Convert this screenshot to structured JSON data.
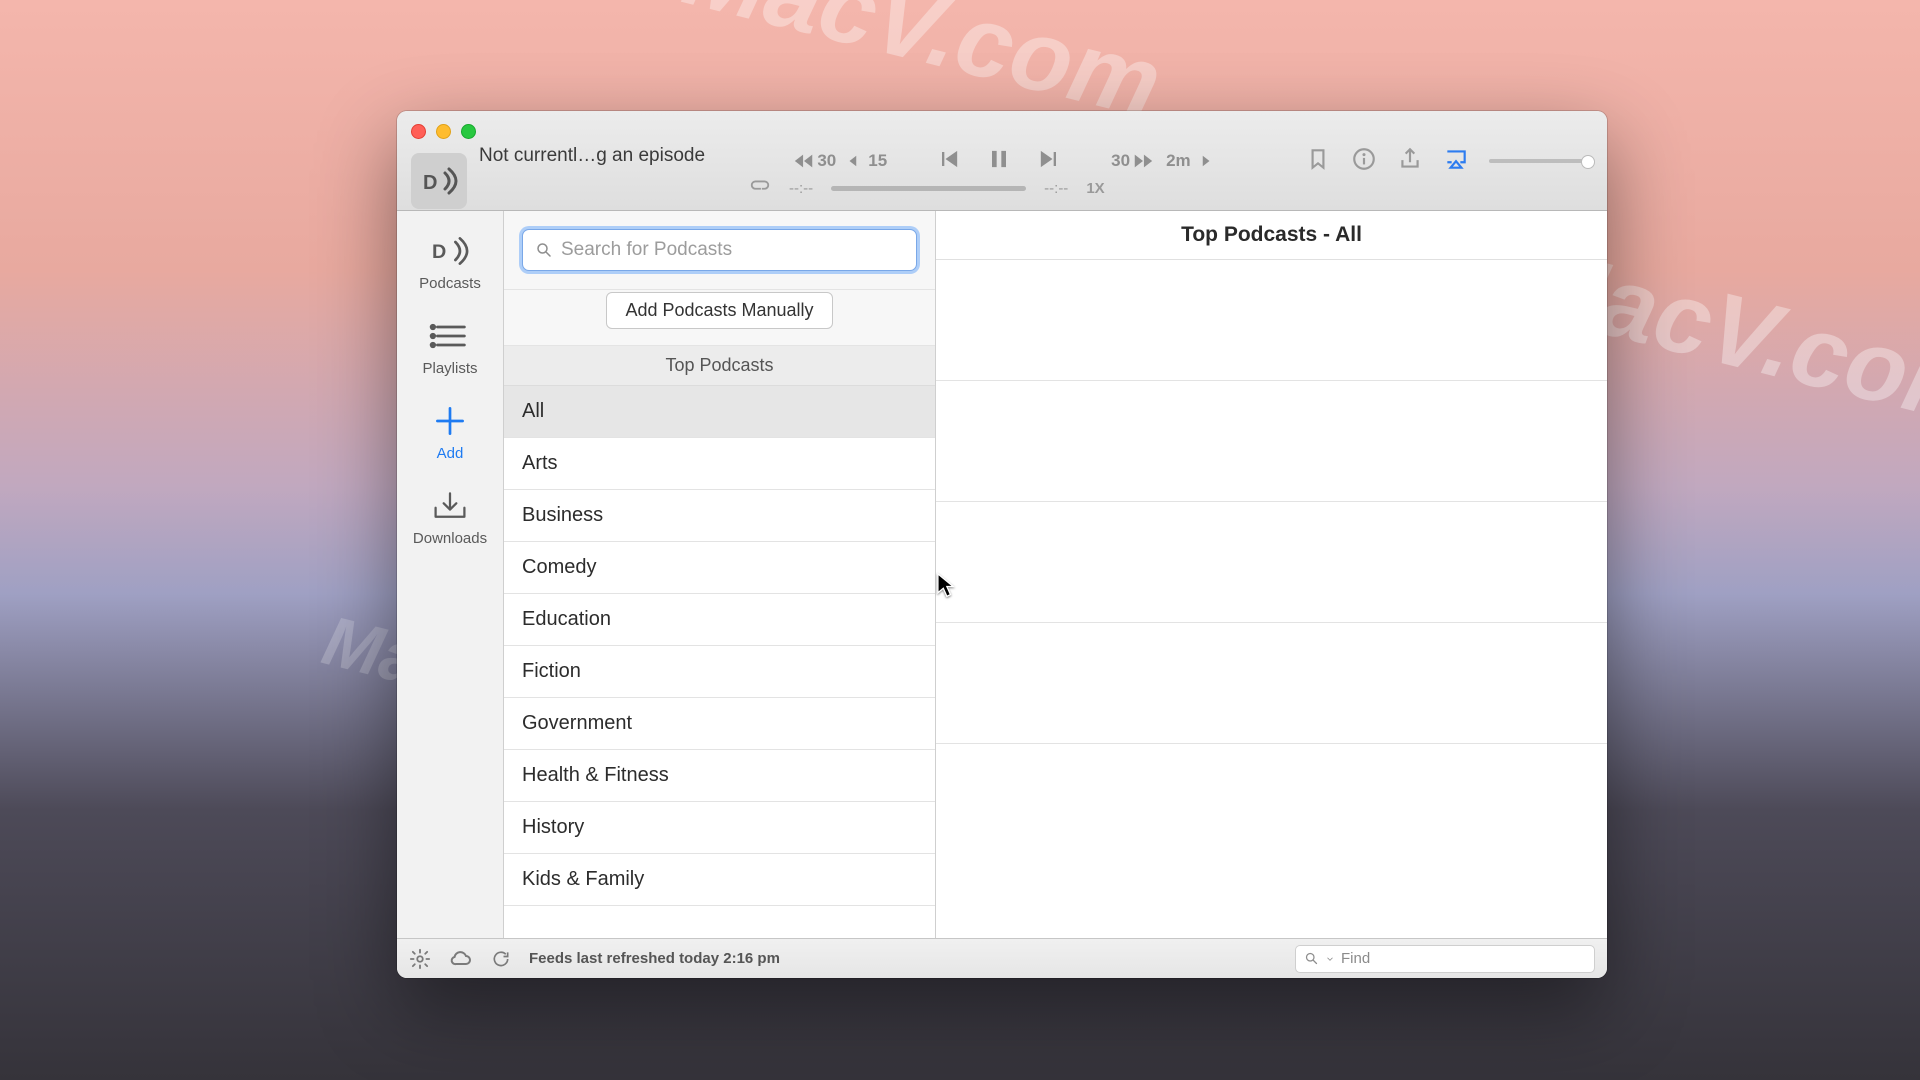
{
  "window": {
    "title": "Not currentl…g an episode"
  },
  "player": {
    "back_seconds": "30",
    "back_small": "15",
    "fwd_seconds": "30",
    "fwd_large": "2m",
    "time_left": "--:--",
    "time_right": "--:--",
    "rate": "1X"
  },
  "sidebar": {
    "items": [
      {
        "label": "Podcasts"
      },
      {
        "label": "Playlists"
      },
      {
        "label": "Add"
      },
      {
        "label": "Downloads"
      }
    ]
  },
  "search": {
    "placeholder": "Search for Podcasts"
  },
  "add_manual_label": "Add Podcasts Manually",
  "top_podcasts_header": "Top Podcasts",
  "categories": [
    "All",
    "Arts",
    "Business",
    "Comedy",
    "Education",
    "Fiction",
    "Government",
    "Health & Fitness",
    "History",
    "Kids & Family"
  ],
  "detail_title": "Top Podcasts - All",
  "status": {
    "text": "Feeds last refreshed today 2:16 pm"
  },
  "find": {
    "placeholder": "Find"
  },
  "watermark": "MacV.com"
}
